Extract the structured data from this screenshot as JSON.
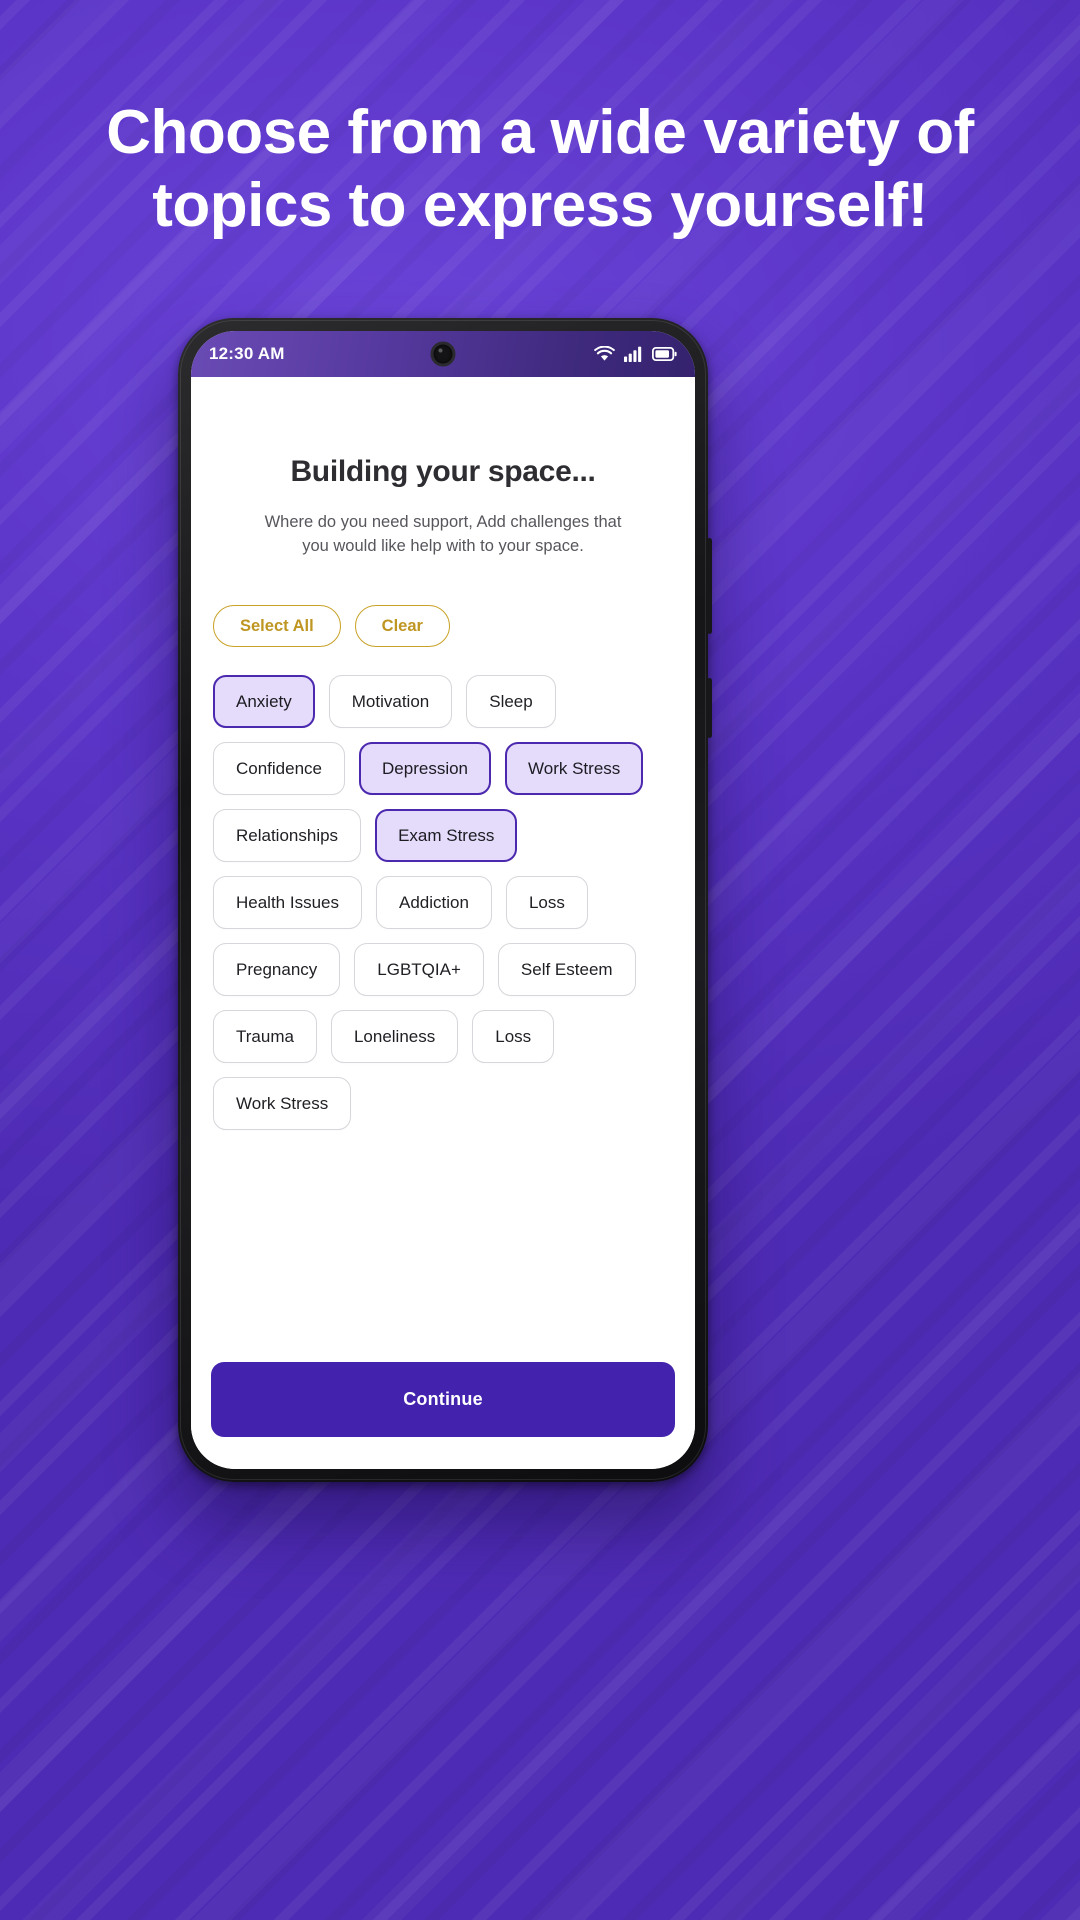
{
  "promo": {
    "headline_lines": [
      "Choose from a wide variety of",
      "topics to express yourself!"
    ],
    "background_color": "#5b35c8"
  },
  "phone": {
    "status_bar": {
      "time": "12:30 AM",
      "icons": [
        "wifi-icon",
        "cellular-signal-icon",
        "battery-icon"
      ],
      "camera": "front-camera-punch-hole"
    }
  },
  "app": {
    "title": "Building your space...",
    "subtitle_lines": [
      "Where do you need support, Add challenges that",
      "you would like help with to your space."
    ],
    "actions": {
      "select_all_label": "Select All",
      "clear_label": "Clear",
      "accent_color": "#c9a227"
    },
    "chips": [
      {
        "label": "Anxiety",
        "selected": true
      },
      {
        "label": "Motivation",
        "selected": false
      },
      {
        "label": "Sleep",
        "selected": false
      },
      {
        "label": "Confidence",
        "selected": false
      },
      {
        "label": "Depression",
        "selected": true
      },
      {
        "label": "Work Stress",
        "selected": true
      },
      {
        "label": "Relationships",
        "selected": false
      },
      {
        "label": "Exam Stress",
        "selected": true
      },
      {
        "label": "Health Issues",
        "selected": false
      },
      {
        "label": "Addiction",
        "selected": false
      },
      {
        "label": "Loss",
        "selected": false
      },
      {
        "label": "Pregnancy",
        "selected": false
      },
      {
        "label": "LGBTQIA+",
        "selected": false
      },
      {
        "label": "Self Esteem",
        "selected": false
      },
      {
        "label": "Trauma",
        "selected": false
      },
      {
        "label": "Loneliness",
        "selected": false
      },
      {
        "label": "Loss",
        "selected": false
      },
      {
        "label": "Work Stress",
        "selected": false
      }
    ],
    "chip_selected_fill": "#e5dbfb",
    "chip_selected_border": "#4b29ae",
    "continue_label": "Continue",
    "continue_color": "#4322ad"
  }
}
